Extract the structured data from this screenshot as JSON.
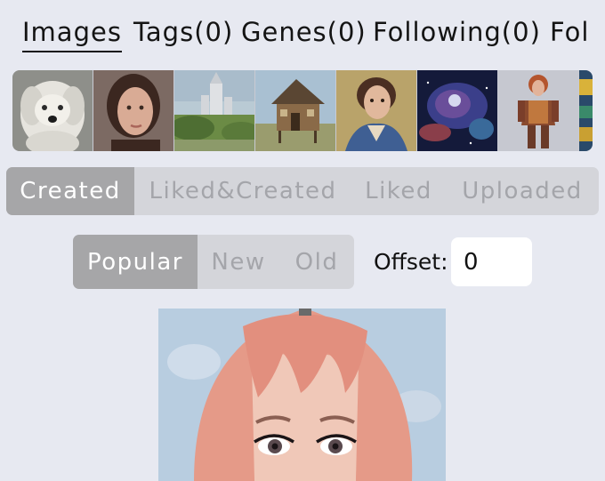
{
  "top_tabs": [
    {
      "label": "Images",
      "active": true
    },
    {
      "label": "Tags(0)",
      "active": false
    },
    {
      "label": "Genes(0)",
      "active": false
    },
    {
      "label": "Following(0)",
      "active": false
    },
    {
      "label": "Fol",
      "active": false
    }
  ],
  "thumbnails": [
    {
      "name": "white-dog"
    },
    {
      "name": "woman-portrait"
    },
    {
      "name": "castle-landscape"
    },
    {
      "name": "wooden-house"
    },
    {
      "name": "painted-woman"
    },
    {
      "name": "nebula"
    },
    {
      "name": "armored-warrior"
    },
    {
      "name": "colorful-partial"
    }
  ],
  "source_filter": {
    "options": [
      "Created",
      "Liked&Created",
      "Liked",
      "Uploaded"
    ],
    "selected": "Created"
  },
  "sort_filter": {
    "options": [
      "Popular",
      "New",
      "Old"
    ],
    "selected": "Popular"
  },
  "offset": {
    "label": "Offset:",
    "value": "0"
  },
  "main_image": {
    "subject": "pink-haired-girl-portrait"
  }
}
